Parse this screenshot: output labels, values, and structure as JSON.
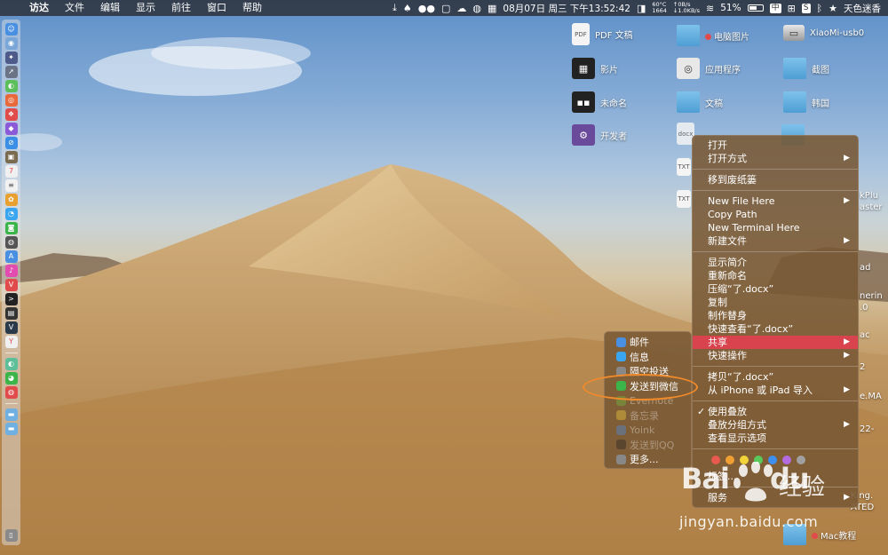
{
  "menubar": {
    "apple": "",
    "app_name": "访达",
    "items": [
      "文件",
      "编辑",
      "显示",
      "前往",
      "窗口",
      "帮助"
    ],
    "status": {
      "temp": "60°C",
      "rpm": "1664",
      "up_speed": "↑0B/s",
      "down_speed": "↓1.0KB/s",
      "datetime": "08月07日 周三 下午13:52:42",
      "battery": "51%",
      "input_method": "中",
      "user": "天色迷香",
      "battery_level": 0.51
    }
  },
  "desktop_icons": [
    {
      "label": "PDF 文稿",
      "icon": "document-icon"
    },
    {
      "label": "电脑图片",
      "icon": "folder-icon",
      "tag": "red"
    },
    {
      "label": "XiaoMi-usb0",
      "icon": "drive-icon"
    },
    {
      "label": "影片",
      "icon": "film-icon"
    },
    {
      "label": "应用程序",
      "icon": "app-folder-icon"
    },
    {
      "label": "截图",
      "icon": "folder-icon"
    },
    {
      "label": "未命名",
      "icon": "terminal-icon"
    },
    {
      "label": "文稿",
      "icon": "folder-icon"
    },
    {
      "label": "韩国",
      "icon": "folder-icon"
    },
    {
      "label": "开发者",
      "icon": "developer-icon"
    },
    {
      "label": "Mac教程",
      "icon": "folder-icon",
      "tag": "red"
    }
  ],
  "partial_labels": [
    "kPlu",
    "aster",
    "ad",
    "nerin",
    ".0",
    "ac",
    "2",
    "e.MA",
    "22-",
    "King.",
    "ATED",
    "Mac教程"
  ],
  "context_menu": {
    "groups": [
      [
        {
          "label": "打开"
        },
        {
          "label": "打开方式",
          "submenu": true
        }
      ],
      [
        {
          "label": "移到废纸篓"
        }
      ],
      [
        {
          "label": "New File Here",
          "submenu": true
        },
        {
          "label": "Copy Path"
        },
        {
          "label": "New Terminal Here"
        },
        {
          "label": "新建文件",
          "submenu": true
        }
      ],
      [
        {
          "label": "显示简介"
        },
        {
          "label": "重新命名"
        },
        {
          "label": "压缩“了.docx”"
        },
        {
          "label": "复制"
        },
        {
          "label": "制作替身"
        },
        {
          "label": "快速查看“了.docx”"
        },
        {
          "label": "共享",
          "submenu": true,
          "highlighted": true
        },
        {
          "label": "快速操作",
          "submenu": true
        }
      ],
      [
        {
          "label": "拷贝“了.docx”"
        },
        {
          "label": "从 iPhone 或 iPad 导入",
          "submenu": true
        }
      ],
      [
        {
          "label": "使用叠放",
          "checked": true
        },
        {
          "label": "叠放分组方式",
          "submenu": true
        },
        {
          "label": "查看显示选项"
        }
      ]
    ],
    "tag_colors": [
      "#e85a4f",
      "#f0a033",
      "#f2d33a",
      "#5ac85a",
      "#3d8ff0",
      "#b46be0",
      "#a0a0a0"
    ],
    "tags_label": "标签...",
    "services_label": "服务"
  },
  "share_menu": {
    "items": [
      {
        "label": "邮件",
        "icon": "mail-icon",
        "color": "#4a90e2"
      },
      {
        "label": "信息",
        "icon": "messages-icon",
        "color": "#3aa6f0"
      },
      {
        "label": "隔空投送",
        "icon": "airdrop-icon",
        "color": "#888888"
      },
      {
        "label": "发送到微信",
        "icon": "wechat-icon",
        "color": "#3bb44a"
      },
      {
        "label": "Evernote",
        "icon": "evernote-icon",
        "color": "#6fbf3f",
        "faded": true
      },
      {
        "label": "备忘录",
        "icon": "notes-icon",
        "color": "#f2d33a",
        "faded": true
      },
      {
        "label": "Yoink",
        "icon": "yoink-icon",
        "color": "#4a90e2",
        "faded": true
      },
      {
        "label": "发送到QQ",
        "icon": "qq-icon",
        "color": "#222222",
        "faded": true
      },
      {
        "label": "更多...",
        "icon": "more-icon",
        "color": "#888888"
      }
    ]
  },
  "watermark": {
    "brand": "Bai",
    "brand_tail": "du",
    "cn": "经验",
    "url": "jingyan.baidu.com"
  }
}
